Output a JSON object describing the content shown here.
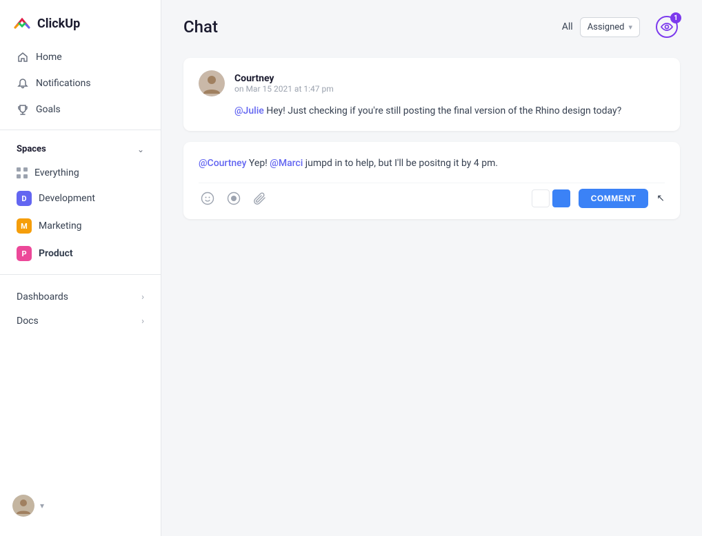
{
  "app": {
    "name": "ClickUp"
  },
  "sidebar": {
    "nav": [
      {
        "id": "home",
        "label": "Home",
        "icon": "home-icon"
      },
      {
        "id": "notifications",
        "label": "Notifications",
        "icon": "bell-icon"
      },
      {
        "id": "goals",
        "label": "Goals",
        "icon": "trophy-icon"
      }
    ],
    "spaces_label": "Spaces",
    "everything_label": "Everything",
    "spaces": [
      {
        "id": "development",
        "label": "Development",
        "initial": "D",
        "badge_class": "badge-dev"
      },
      {
        "id": "marketing",
        "label": "Marketing",
        "initial": "M",
        "badge_class": "badge-mkt"
      },
      {
        "id": "product",
        "label": "Product",
        "initial": "P",
        "badge_class": "badge-prd",
        "bold": true
      }
    ],
    "bottom_nav": [
      {
        "id": "dashboards",
        "label": "Dashboards"
      },
      {
        "id": "docs",
        "label": "Docs"
      }
    ]
  },
  "chat": {
    "title": "Chat",
    "filter_all": "All",
    "filter_assigned": "Assigned",
    "watch_count": "1",
    "messages": [
      {
        "id": "msg1",
        "sender": "Courtney",
        "time": "on Mar 15 2021 at 1:47 pm",
        "mention": "@Julie",
        "text": " Hey! Just checking if you're still posting the final version of the Rhino design today?"
      }
    ],
    "reply": {
      "mention1": "@Courtney",
      "text1": " Yep! ",
      "mention2": "@Marci",
      "text2": " jumpd in to help, but I'll be positng it by 4 pm."
    },
    "comment_button": "COMMENT"
  }
}
